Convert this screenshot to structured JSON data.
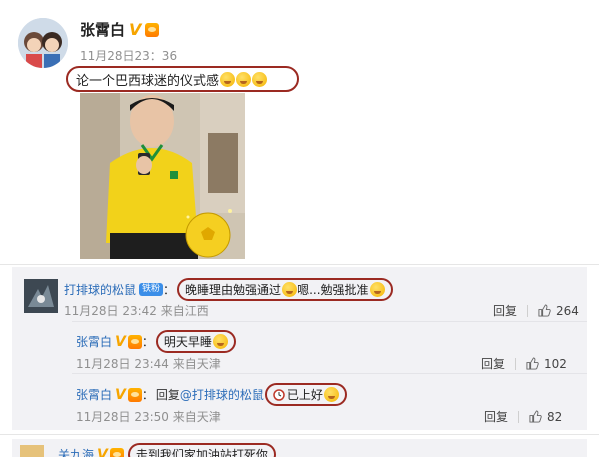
{
  "post": {
    "author": "张霄白",
    "v_badge": "V",
    "timestamp": "11月28日23：36",
    "text": "论一个巴西球迷的仪式感"
  },
  "comments": [
    {
      "user": "打排球的松鼠",
      "badge": "铁粉",
      "colon": "：",
      "text": "晚睡理由勉强通过",
      "text2": "嗯...勉强批准",
      "meta": "11月28日 23:42 来自江西",
      "reply_label": "回复",
      "likes": "264",
      "replies": [
        {
          "user": "张霄白",
          "v_badge": "V",
          "colon": "：",
          "text": "明天早睡",
          "meta": "11月28日 23:44 来自天津",
          "reply_label": "回复",
          "likes": "102"
        },
        {
          "user": "张霄白",
          "v_badge": "V",
          "colon": "：",
          "prefix": "回复",
          "mention": "@打排球的松鼠",
          "text": "已上好",
          "meta": "11月28日 23:50 来自天津",
          "reply_label": "回复",
          "likes": "82"
        }
      ]
    },
    {
      "user": "关九海",
      "v_badge": "V",
      "text": "走到我们家加油站打死你"
    }
  ],
  "colors": {
    "highlight_border": "#9b2a22",
    "link": "#2b6cb8",
    "v_badge": "#f6a500",
    "comment_bg": "#f2f2f5"
  }
}
